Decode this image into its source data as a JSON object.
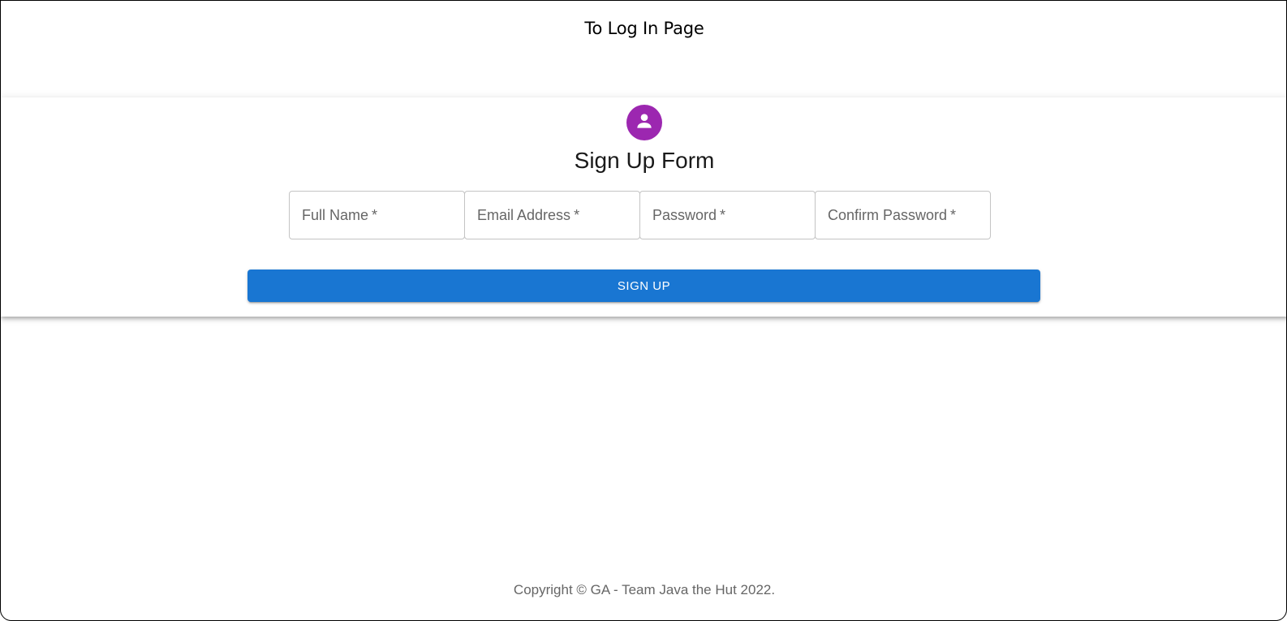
{
  "header": {
    "login_link_label": "To Log In Page"
  },
  "form": {
    "avatar_icon": "person-icon",
    "avatar_color": "#9c27b0",
    "title": "Sign Up Form",
    "fields": [
      {
        "label": "Full Name",
        "required_mark": "*",
        "value": ""
      },
      {
        "label": "Email Address",
        "required_mark": "*",
        "value": ""
      },
      {
        "label": "Password",
        "required_mark": "*",
        "value": ""
      },
      {
        "label": "Confirm Password",
        "required_mark": "*",
        "value": ""
      }
    ],
    "submit_label": "SIGN UP",
    "submit_color": "#1976d2"
  },
  "footer": {
    "copyright": "Copyright © GA - Team Java the Hut 2022."
  }
}
